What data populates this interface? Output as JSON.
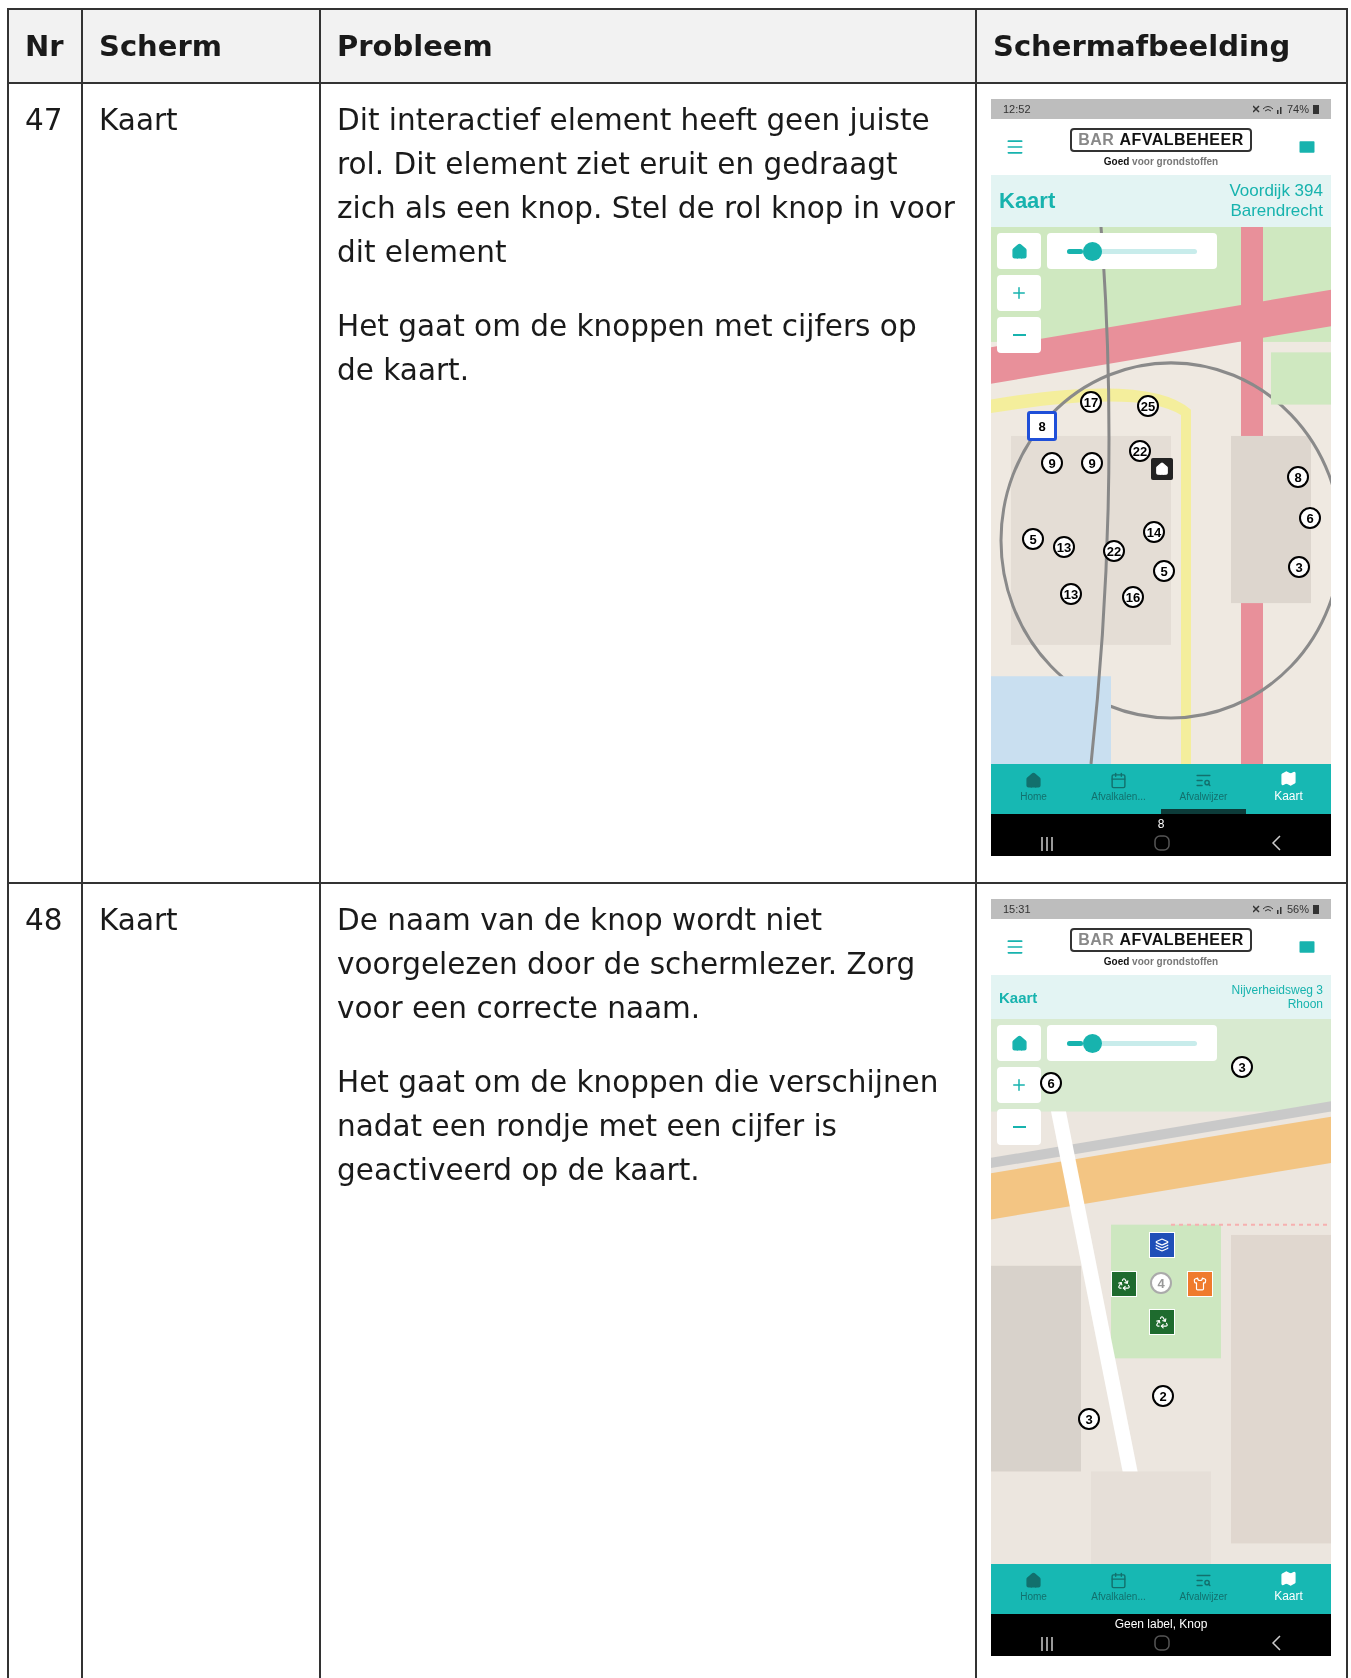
{
  "table": {
    "columns": [
      "Nr",
      "Scherm",
      "Probleem",
      "Schermafbeelding"
    ],
    "rows": [
      {
        "nr": "47",
        "screen": "Kaart",
        "paragraphs": [
          "Dit interactief element heeft geen juiste rol. Dit element ziet eruit en gedraagt zich als een knop. Stel de rol knop in voor dit element",
          "Het gaat om de knoppen met cijfers op de kaart."
        ],
        "screenshot": {
          "time": "12:52",
          "battery": "74%",
          "logo_prefix": "BAR",
          "logo_name": "AFVALBEHEER",
          "tagline": "**Goed** voor grondstoffen",
          "title": "Kaart",
          "address": [
            "Voordijk 394",
            "Barendrecht"
          ],
          "slider": {
            "level": 0.12
          },
          "markers": [
            {
              "kind": "number",
              "label": "17",
              "selected": false
            },
            {
              "kind": "number",
              "label": "25",
              "selected": false
            },
            {
              "kind": "number",
              "label": "8",
              "selected": true
            },
            {
              "kind": "number",
              "label": "9",
              "selected": false
            },
            {
              "kind": "number",
              "label": "9",
              "selected": false
            },
            {
              "kind": "number",
              "label": "22",
              "selected": false
            },
            {
              "kind": "home"
            },
            {
              "kind": "number",
              "label": "8",
              "selected": false
            },
            {
              "kind": "number",
              "label": "6",
              "selected": false
            },
            {
              "kind": "number",
              "label": "5",
              "selected": false
            },
            {
              "kind": "number",
              "label": "13",
              "selected": false
            },
            {
              "kind": "number",
              "label": "22",
              "selected": false
            },
            {
              "kind": "number",
              "label": "14",
              "selected": false
            },
            {
              "kind": "number",
              "label": "5",
              "selected": false
            },
            {
              "kind": "number",
              "label": "3",
              "selected": false
            },
            {
              "kind": "number",
              "label": "13",
              "selected": false
            },
            {
              "kind": "number",
              "label": "16",
              "selected": false
            }
          ],
          "nav": [
            {
              "label": "Home",
              "selected": false,
              "focused": false
            },
            {
              "label": "Afvalkalen...",
              "selected": false,
              "focused": false
            },
            {
              "label": "Afvalwijzer",
              "selected": false,
              "focused": true
            },
            {
              "label": "Kaart",
              "selected": true,
              "focused": false
            }
          ],
          "caption": "8"
        }
      },
      {
        "nr": "48",
        "screen": "Kaart",
        "paragraphs": [
          "De naam van de knop wordt niet voorgelezen door de schermlezer. Zorg voor een correcte naam.",
          "Het gaat om de knoppen die verschijnen nadat een rondje met een cijfer is geactiveerd op de kaart."
        ],
        "screenshot": {
          "time": "15:31",
          "battery": "56%",
          "logo_prefix": "BAR",
          "logo_name": "AFVALBEHEER",
          "tagline": "**Goed** voor grondstoffen",
          "title": "Kaart",
          "address": [
            "Nijverheidsweg 3",
            "Rhoon"
          ],
          "slider": {
            "level": 0.12
          },
          "markers": [
            {
              "kind": "number",
              "label": "6",
              "selected": false
            },
            {
              "kind": "number",
              "label": "3",
              "selected": false
            },
            {
              "kind": "icon",
              "color": "#1f4fb8"
            },
            {
              "kind": "icon",
              "color": "#1e6b2e"
            },
            {
              "kind": "faded",
              "label": "4"
            },
            {
              "kind": "icon",
              "color": "#ef7b2d"
            },
            {
              "kind": "icon",
              "color": "#1e6b2e"
            },
            {
              "kind": "number",
              "label": "2",
              "selected": false
            },
            {
              "kind": "number",
              "label": "3",
              "selected": false
            }
          ],
          "nav": [
            {
              "label": "Home",
              "selected": false,
              "focused": false
            },
            {
              "label": "Afvalkalen...",
              "selected": false,
              "focused": false
            },
            {
              "label": "Afvalwijzer",
              "selected": false,
              "focused": false
            },
            {
              "label": "Kaart",
              "selected": true,
              "focused": false
            }
          ],
          "caption": "Geen label, Knop"
        }
      }
    ]
  }
}
